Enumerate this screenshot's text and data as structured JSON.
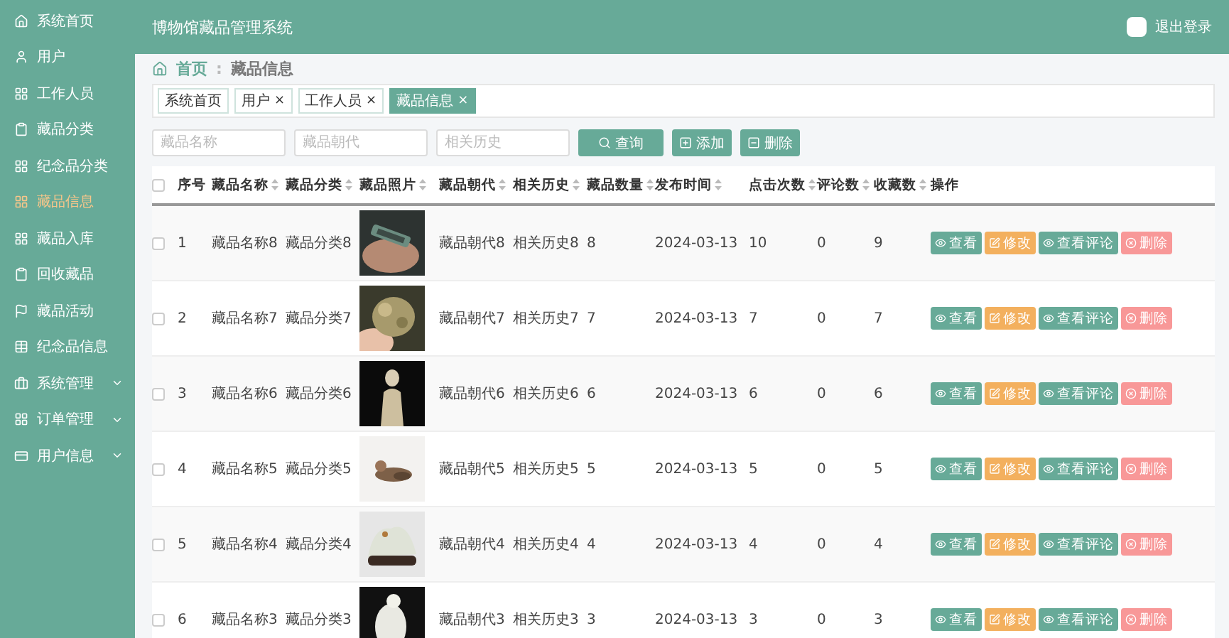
{
  "sidebar": {
    "items": [
      {
        "label": "系统首页",
        "selected": false,
        "expandable": false
      },
      {
        "label": "用户",
        "selected": false,
        "expandable": false
      },
      {
        "label": "工作人员",
        "selected": false,
        "expandable": false
      },
      {
        "label": "藏品分类",
        "selected": false,
        "expandable": false
      },
      {
        "label": "纪念品分类",
        "selected": false,
        "expandable": false
      },
      {
        "label": "藏品信息",
        "selected": true,
        "expandable": false
      },
      {
        "label": "藏品入库",
        "selected": false,
        "expandable": false
      },
      {
        "label": "回收藏品",
        "selected": false,
        "expandable": false
      },
      {
        "label": "藏品活动",
        "selected": false,
        "expandable": false
      },
      {
        "label": "纪念品信息",
        "selected": false,
        "expandable": false
      },
      {
        "label": "系统管理",
        "selected": false,
        "expandable": true
      },
      {
        "label": "订单管理",
        "selected": false,
        "expandable": true
      },
      {
        "label": "用户信息",
        "selected": false,
        "expandable": true
      }
    ]
  },
  "header": {
    "title": "博物馆藏品管理系统",
    "logout": "退出登录"
  },
  "breadcrumb": {
    "home": "首页",
    "separator": ":",
    "current": "藏品信息"
  },
  "tags": [
    {
      "label": "系统首页",
      "selected": false
    },
    {
      "label": "用户",
      "close": "×",
      "selected": false
    },
    {
      "label": "工作人员",
      "close": "×",
      "selected": false
    },
    {
      "label": "藏品信息",
      "close": "×",
      "selected": true
    }
  ],
  "search": {
    "fields": [
      {
        "placeholder": "藏品名称"
      },
      {
        "placeholder": "藏品朝代"
      },
      {
        "placeholder": "相关历史"
      }
    ],
    "buttons": [
      {
        "label": "查询",
        "kind": "search"
      },
      {
        "label": "添加",
        "kind": "add"
      },
      {
        "label": "删除",
        "kind": "delete"
      }
    ]
  },
  "table": {
    "header_checked": false,
    "columns": [
      {
        "label": "序号",
        "sortable": false
      },
      {
        "label": "藏品名称",
        "sortable": true
      },
      {
        "label": "藏品分类",
        "sortable": true
      },
      {
        "label": "藏品照片",
        "sortable": true,
        "kind": "picture"
      },
      {
        "label": "藏品朝代",
        "sortable": true
      },
      {
        "label": "相关历史",
        "sortable": true
      },
      {
        "label": "藏品数量",
        "sortable": true
      },
      {
        "label": "发布时间",
        "sortable": true
      },
      {
        "label": "点击次数",
        "sortable": true
      },
      {
        "label": "评论数",
        "sortable": true
      },
      {
        "label": "收藏数",
        "sortable": true
      },
      {
        "label": "操作",
        "sortable": false
      }
    ],
    "rows": [
      {
        "checked": false,
        "cells": [
          "1",
          "藏品名称8",
          "藏品分类8",
          "",
          "藏品朝代8",
          "相关历史8",
          "8",
          "2024-03-13",
          "10",
          "0",
          "9"
        ],
        "actions": [
          {
            "label": "查看",
            "kind": "view"
          },
          {
            "label": "修改",
            "kind": "edit"
          },
          {
            "label": "查看评论",
            "kind": "view"
          },
          {
            "label": "删除",
            "kind": "delete"
          }
        ]
      },
      {
        "checked": false,
        "cells": [
          "2",
          "藏品名称7",
          "藏品分类7",
          "",
          "藏品朝代7",
          "相关历史7",
          "7",
          "2024-03-13",
          "7",
          "0",
          "7"
        ],
        "actions": [
          {
            "label": "查看",
            "kind": "view"
          },
          {
            "label": "修改",
            "kind": "edit"
          },
          {
            "label": "查看评论",
            "kind": "view"
          },
          {
            "label": "删除",
            "kind": "delete"
          }
        ]
      },
      {
        "checked": false,
        "cells": [
          "3",
          "藏品名称6",
          "藏品分类6",
          "",
          "藏品朝代6",
          "相关历史6",
          "6",
          "2024-03-13",
          "6",
          "0",
          "6"
        ],
        "actions": [
          {
            "label": "查看",
            "kind": "view"
          },
          {
            "label": "修改",
            "kind": "edit"
          },
          {
            "label": "查看评论",
            "kind": "view"
          },
          {
            "label": "删除",
            "kind": "delete"
          }
        ]
      },
      {
        "checked": false,
        "cells": [
          "4",
          "藏品名称5",
          "藏品分类5",
          "",
          "藏品朝代5",
          "相关历史5",
          "5",
          "2024-03-13",
          "5",
          "0",
          "5"
        ],
        "actions": [
          {
            "label": "查看",
            "kind": "view"
          },
          {
            "label": "修改",
            "kind": "edit"
          },
          {
            "label": "查看评论",
            "kind": "view"
          },
          {
            "label": "删除",
            "kind": "delete"
          }
        ]
      },
      {
        "checked": false,
        "cells": [
          "5",
          "藏品名称4",
          "藏品分类4",
          "",
          "藏品朝代4",
          "相关历史4",
          "4",
          "2024-03-13",
          "4",
          "0",
          "4"
        ],
        "actions": [
          {
            "label": "查看",
            "kind": "view"
          },
          {
            "label": "修改",
            "kind": "edit"
          },
          {
            "label": "查看评论",
            "kind": "view"
          },
          {
            "label": "删除",
            "kind": "delete"
          }
        ]
      },
      {
        "checked": false,
        "cells": [
          "6",
          "藏品名称3",
          "藏品分类3",
          "",
          "藏品朝代3",
          "相关历史3",
          "3",
          "2024-03-13",
          "3",
          "0",
          "3"
        ],
        "actions": [
          {
            "label": "查看",
            "kind": "view"
          },
          {
            "label": "修改",
            "kind": "edit"
          },
          {
            "label": "查看评论",
            "kind": "view"
          },
          {
            "label": "删除",
            "kind": "delete"
          }
        ]
      }
    ]
  }
}
